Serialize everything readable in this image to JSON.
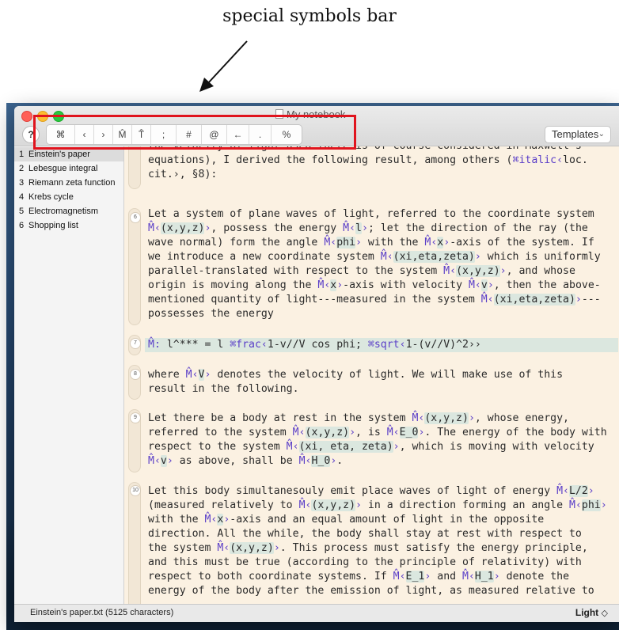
{
  "annotation": {
    "label": "special symbols bar"
  },
  "window": {
    "title": "My notebook"
  },
  "toolbar": {
    "help_label": "?",
    "symbols": [
      "⌘",
      "‹",
      "›",
      "M̂",
      "T̂",
      ";",
      "#",
      "@",
      "←",
      ".",
      "%"
    ],
    "templates_label": "Templates",
    "templates_chevron": "⌄"
  },
  "sidebar": {
    "items": [
      {
        "num": "1",
        "label": "Einstein's paper"
      },
      {
        "num": "2",
        "label": "Lebesgue integral"
      },
      {
        "num": "3",
        "label": "Riemann zeta function"
      },
      {
        "num": "4",
        "label": "Krebs cycle"
      },
      {
        "num": "5",
        "label": "Electromagnetism"
      },
      {
        "num": "6",
        "label": "Shopping list"
      }
    ],
    "toolbar": {
      "add": "+",
      "remove": "−",
      "grid": "⊞",
      "gear": "✱"
    }
  },
  "editor": {
    "cells": [
      {
        "number": "",
        "lines": [
          "the velocity of light used there is of course considered in Maxwell's",
          "equations), I derived the following result, among others (⌘italic‹loc.",
          "cit.›, §8):"
        ]
      },
      {
        "number": "6",
        "lines": [
          "Let a system of plane waves of light, referred to the coordinate system",
          "M̂‹(x,y,z)›, possess the energy M̂‹l›; let the direction of the ray (the",
          "wave normal) form the angle M̂‹phi› with the M̂‹x›-axis of the system. If",
          "we introduce a new coordinate system M̂‹(xi,eta,zeta)› which is uniformly",
          "parallel-translated with respect to the system M̂‹(x,y,z)›, and whose",
          "origin is moving along the M̂‹x›-axis with velocity M̂‹v›, then the above-",
          "mentioned quantity of light---measured in the system M̂‹(xi,eta,zeta)›---",
          "possesses the energy"
        ]
      },
      {
        "number": "7",
        "lines": [
          "M̂: l^*** = l ⌘frac‹1-v//V cos phi; ⌘sqrt‹1-(v//V)^2››"
        ]
      },
      {
        "number": "8",
        "lines": [
          "where M̂‹V› denotes the velocity of light. We will make use of this",
          "result in the following."
        ]
      },
      {
        "number": "9",
        "lines": [
          "Let there be a body at rest in the system M̂‹(x,y,z)›, whose energy,",
          "referred to the system M̂‹(x,y,z)›, is M̂‹E_0›. The energy of the body with",
          "respect to the system M̂‹(xi, eta, zeta)›, which is moving with velocity",
          "M̂‹v› as above, shall be M̂‹H_0›."
        ]
      },
      {
        "number": "10",
        "lines": [
          "Let this body simultanesouly emit place waves of light of energy M̂‹L/2›",
          "(measured relatively to M̂‹(x,y,z)› in a direction forming an angle M̂‹phi›",
          "with the M̂‹x›-axis and an equal amount of light in the opposite",
          "direction. All the while, the body shall stay at rest with respect to",
          "the system M̂‹(x,y,z)›. This process must satisfy the energy principle,",
          "and this must be true (according to the principle of relativity) with",
          "respect to both coordinate systems. If M̂‹E_1› and M̂‹H_1› denote the",
          "energy of the body after the emission of light, as measured relative to"
        ]
      }
    ]
  },
  "status": {
    "file_info": "Einstein's paper.txt (5125 characters)",
    "theme": "Light",
    "theme_chevron": "◇"
  },
  "colors": {
    "highlight_box": "#e0141e",
    "math_marker": "#5a3ec8",
    "editor_background": "#fbf1e2",
    "math_background": "#dbe7df"
  }
}
